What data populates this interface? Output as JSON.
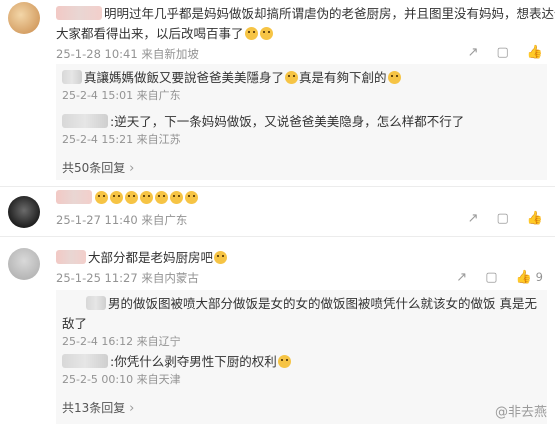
{
  "comments": [
    {
      "text": "明明过年几乎都是妈妈做饭却搞所谓虐伪的老爸厨房，并且图里没有妈妈，想表达什么",
      "text2": "大家都看得出来，以后改喝百事了",
      "meta": "25-1-28 10:41 来自新加坡",
      "replies": [
        {
          "text": "真讓媽媽做飯又要說爸爸美美隱身了",
          "text_b": "真是有夠下創的",
          "meta": "25-2-4 15:01 来自广东"
        },
        {
          "text": ":逆天了，下一条妈妈做饭，又说爸爸美美隐身，怎么样都不行了",
          "meta": "25-2-4 15:21 来自江苏"
        }
      ],
      "more": "共50条回复",
      "share_count": "",
      "comment_count": "",
      "like_count": ""
    },
    {
      "meta": "25-1-27 11:40 来自广东"
    },
    {
      "text": "大部分都是老妈厨房吧",
      "meta": "25-1-25 11:27 来自内蒙古",
      "like_count": "9",
      "replies": [
        {
          "text": "男的做饭图被喷大部分做饭是女的女的做饭图被喷凭什么就该女的做饭 真是无敌了",
          "meta": "25-2-4 16:12 来自辽宁"
        },
        {
          "text": ":你凭什么剥夺男性下厨的权利",
          "meta": "25-2-5 00:10 来自天津"
        }
      ],
      "more": "共13条回复"
    }
  ],
  "watermark": "@非去燕",
  "icons": [
    "share-icon",
    "comment-icon",
    "like-icon",
    "chevron-right-icon"
  ]
}
